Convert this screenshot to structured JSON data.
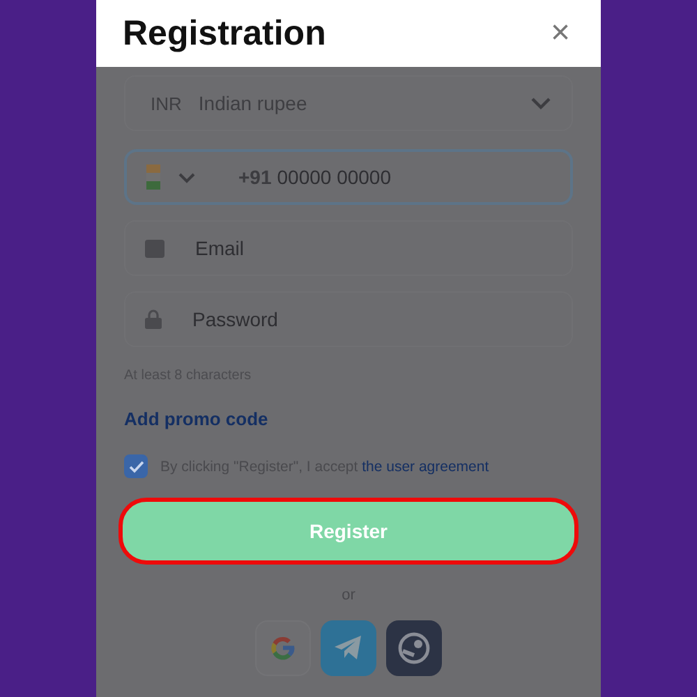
{
  "modal": {
    "title": "Registration",
    "close": "×"
  },
  "currency": {
    "code": "INR",
    "name": "Indian rupee"
  },
  "phone": {
    "prefix": "+91",
    "placeholder": "00000 00000"
  },
  "email": {
    "placeholder": "Email"
  },
  "password": {
    "placeholder": "Password",
    "hint": "At least 8 characters"
  },
  "promo_link": "Add promo code",
  "agreement": {
    "checked": true,
    "text": "By clicking \"Register\", I accept",
    "link": "the user agreement"
  },
  "register_button": {
    "label": "Register",
    "highlighted": true
  },
  "divider_text": "or",
  "social": [
    {
      "kind": "google"
    },
    {
      "kind": "telegram"
    },
    {
      "kind": "steam"
    }
  ]
}
